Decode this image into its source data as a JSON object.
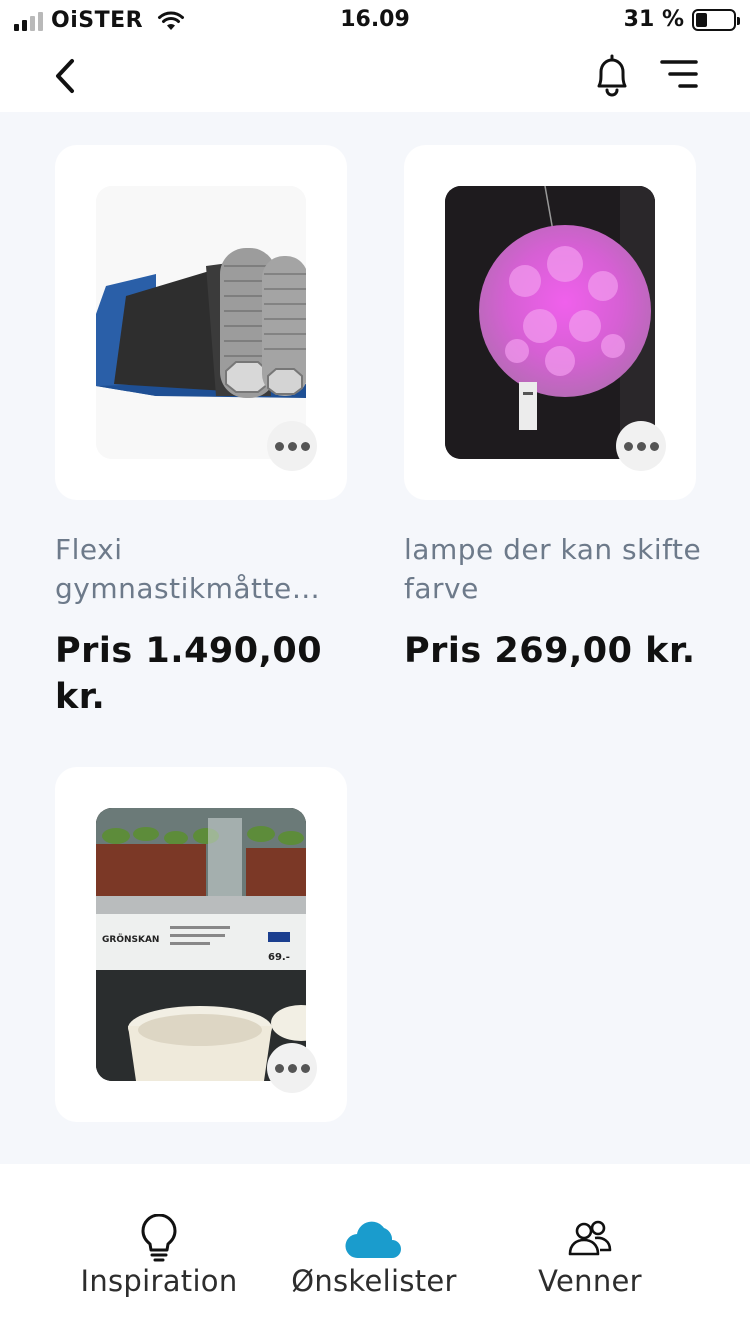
{
  "status_bar": {
    "carrier": "OiSTER",
    "time": "16.09",
    "battery_percent": "31 %",
    "battery_level": 0.31
  },
  "nav": {
    "back_icon": "chevron-left-icon",
    "bell_icon": "bell-icon",
    "filter_icon": "filter-lines-icon"
  },
  "items": [
    {
      "title": "Flexi gymnastikmåtte…",
      "price": "Pris 1.490,00 kr.",
      "image": "gymnastics-mat-photo"
    },
    {
      "title": "lampe der kan skifte farve",
      "price": "Pris 269,00 kr.",
      "image": "pink-lamp-photo"
    },
    {
      "title": "",
      "price": "",
      "image": "plant-pots-photo",
      "shelf_label": "GRÖNSKAN",
      "shelf_price": "69.-"
    }
  ],
  "tabs": [
    {
      "label": "Inspiration",
      "icon": "lightbulb-icon",
      "active": false
    },
    {
      "label": "Ønskelister",
      "icon": "cloud-icon",
      "active": true,
      "color": "#1a9ccd"
    },
    {
      "label": "Venner",
      "icon": "friends-icon",
      "active": false
    }
  ]
}
